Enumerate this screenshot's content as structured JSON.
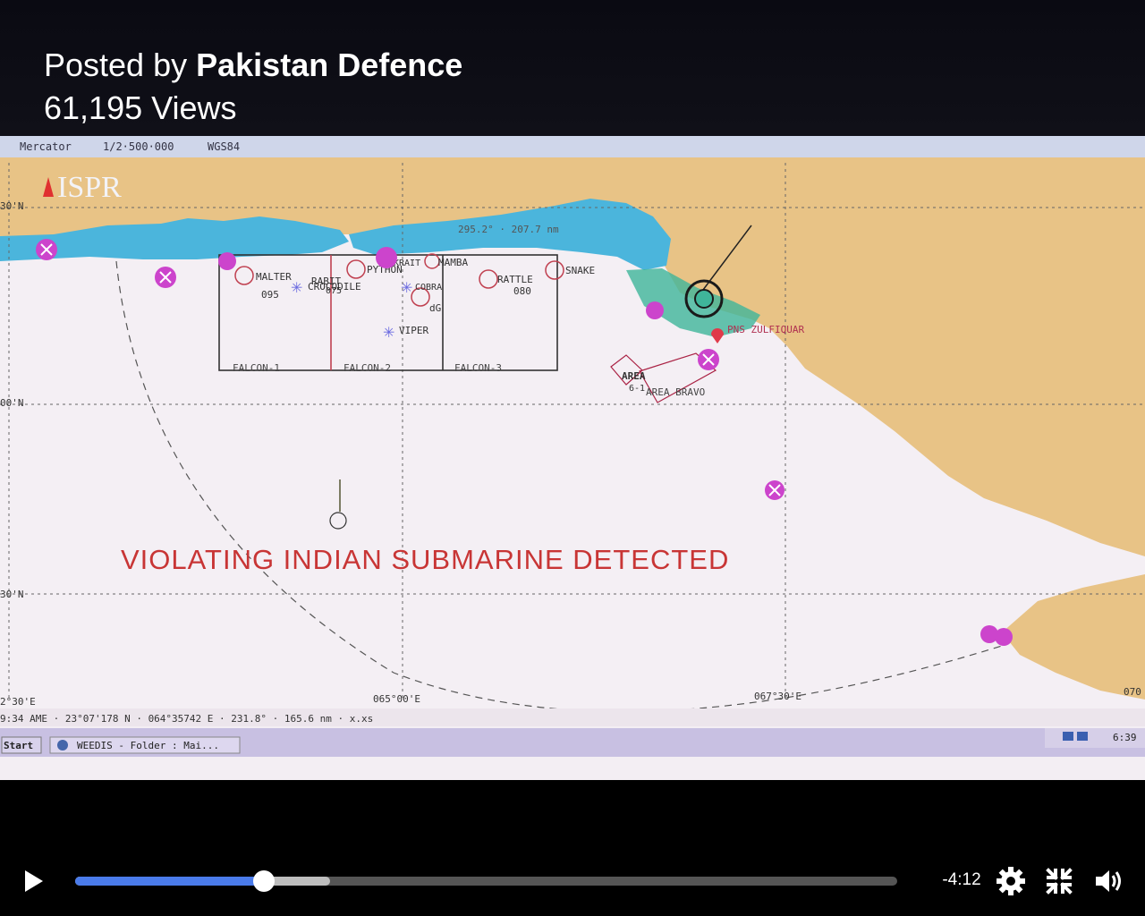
{
  "header": {
    "posted_prefix": "Posted by",
    "author": "Pakistan Defence",
    "views": "61,195 Views"
  },
  "chart_screen": {
    "top_bar": {
      "projection": "Mercator",
      "scale": "1/2·500·000",
      "datum": "WGS84"
    },
    "watermark": "ISPR",
    "range_text": "295.2° · 207.7 nm",
    "lat_labels": [
      "30'N",
      "00'N",
      "30'N",
      "2°30'E"
    ],
    "lon_labels": [
      "065°00'E",
      "067°30'E",
      "070"
    ],
    "sonobuoys": [
      "MALTER",
      "RABIT",
      "PYTHON",
      "MAMBA",
      "RATTLE",
      "SNAKE",
      "CROCODILE",
      "COBRA",
      "VIPER",
      "KRAIT"
    ],
    "numbers": [
      "095",
      "075",
      "080",
      "dG"
    ],
    "boxes": [
      "FALCON-1",
      "FALCON-2",
      "FALCON-3"
    ],
    "areas": [
      "AREA",
      "6-1",
      "AREA BRAVO"
    ],
    "ship": "PNS ZULFIQUAR",
    "alert": "VIOLATING INDIAN SUBMARINE DETECTED",
    "status_line": "9:34 AME · 23°07'178 N · 064°35742 E · 231.8° · 165.6 nm · x.xs",
    "taskbar": {
      "start": "Start",
      "window": "WEEDIS - Folder : Mai...",
      "clock": "6:39"
    }
  },
  "player": {
    "time_remaining": "-4:12",
    "progress_fraction": 0.23,
    "buffered_fraction": 0.31,
    "icons": [
      "play-icon",
      "settings-gear-icon",
      "fullscreen-icon",
      "volume-icon"
    ],
    "accent_color": "#4a7bea"
  }
}
